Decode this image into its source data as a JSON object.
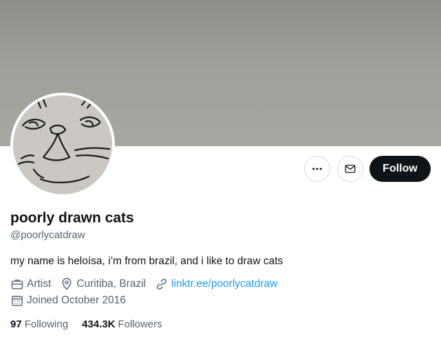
{
  "profile": {
    "display_name": "poorly drawn cats",
    "handle": "@poorlycatdraw",
    "bio": "my name is heloísa, i’m from brazil, and i like to draw cats",
    "category": "Artist",
    "location": "Curitiba, Brazil",
    "website": "linktr.ee/poorlycatdraw",
    "joined": "Joined October 2016"
  },
  "stats": {
    "following_count": "97",
    "following_label": "Following",
    "followers_count": "434.3K",
    "followers_label": "Followers"
  },
  "actions": {
    "follow_label": "Follow",
    "more_icon": "more-horizontal-icon",
    "message_icon": "envelope-icon"
  },
  "icons": {
    "category": "briefcase-icon",
    "location": "location-pin-icon",
    "website": "link-icon",
    "joined": "calendar-icon"
  },
  "colors": {
    "accent": "#1d9bf0",
    "text_primary": "#0f1419",
    "text_secondary": "#536471",
    "follow_button_bg": "#0f1419"
  }
}
